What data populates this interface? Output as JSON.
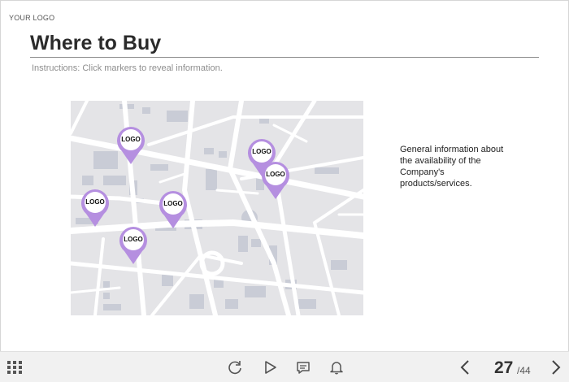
{
  "header": {
    "logo": "YOUR LOGO",
    "title": "Where to Buy",
    "instructions": "Instructions: Click markers to reveal information."
  },
  "map": {
    "markers": [
      {
        "label": "LOGO"
      },
      {
        "label": "LOGO"
      },
      {
        "label": "LOGO"
      },
      {
        "label": "LOGO"
      },
      {
        "label": "LOGO"
      },
      {
        "label": "LOGO"
      }
    ],
    "marker_color": "#b58fe0"
  },
  "info": {
    "text": "General information about the availability of the Company's products/services."
  },
  "nav": {
    "current_page": "27",
    "total_pages": "/44",
    "icons": [
      "menu-grid-icon",
      "replay-icon",
      "play-icon",
      "captions-icon",
      "bell-icon",
      "prev-icon",
      "next-icon"
    ]
  }
}
